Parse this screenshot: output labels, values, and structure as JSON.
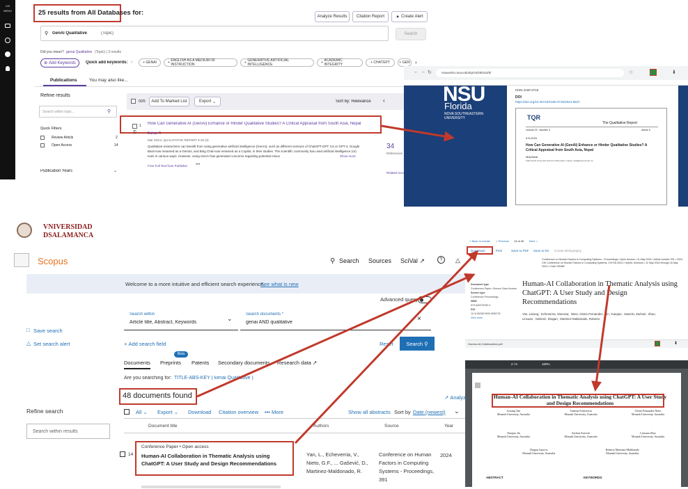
{
  "wos": {
    "rail_items": [
      "LIB",
      "MENU"
    ],
    "results_heading": "25 results from All Databases for:",
    "analyze_btn": "Analyze Results",
    "citation_btn": "Citation Report",
    "alert_btn": "Create Alert",
    "query": "GenAI Qualitative",
    "query_suffix": "(Topic)",
    "search_btn": "Search",
    "did_you_mean": "Did you mean?",
    "did_you_mean_value": "genai Qualitative",
    "did_you_mean_rest": "(Topic) | 3 results",
    "add_keywords": "Add Keywords",
    "quick_add": "Quick add keywords:",
    "chips": [
      "GENAI",
      "ENGLISH AS A MEDIUM OF INSTRUCTION",
      "GENERATIVE ARTIFICIAL INTELLIGENCE",
      "ACADEMIC INTEGRITY",
      "CHATGPT",
      "GEN"
    ],
    "tab_publications": "Publications",
    "tab_also_like": "You may also like...",
    "refine": "Refine results",
    "search_within_ph": "Search within topic...",
    "quick_filters": "Quick Filters",
    "filters": [
      {
        "label": "Review Article",
        "count": "2"
      },
      {
        "label": "Open Access",
        "count": "14"
      }
    ],
    "pub_years": "Publication Years",
    "selected": "0/25",
    "add_marked": "Add To Marked List",
    "export": "Export",
    "sort_by": "Sort by: Relevance",
    "record_num": "1",
    "record_title": "How Can Generative AI (GenAI) Enhance or Hinder Qualitative Studies? A Critical Appraisal from South Asia, Nepal",
    "record_author": "Bahat, R",
    "record_meta": "Mar 2024 | QUALITATIVE REPORT ▾ 29 (3)",
    "abstract_line1": "Qualitative researchers can benefit from using generative artificial intelligence (GenAI), such as different versions of ChatGPT-GPT 3.5 or GPT-4, Google",
    "abstract_line2": "Bard-now renamed as a Gemini, and Bing Chat-now renamed as a Copilot, in their studies. The scientific community has used artificial intelligence (AI)",
    "abstract_line3": "tools in various ways. However, using GenAI has generated concerns regarding potential misus",
    "show_more": "Show more",
    "full_text": "Free Full Text from Publisher",
    "citations": "34",
    "citations_label": "References",
    "related": "Related records"
  },
  "nsu": {
    "url": "nsuworks.nova.edu/tqr/vol29/iss3/5/",
    "logo": "NSU",
    "florida": "Florida",
    "sub1": "NOVA SOUTHEASTERN",
    "sub2": "UNIVERSITY",
    "issn_label": "ISSN 2160-3715",
    "doi_label": "DOI",
    "doi": "https://doi.org/10.46743/2160-3715/2024.6637",
    "tqr": "TQR",
    "tqr_full": "The Qualitative Report",
    "vol": "Volume 29 · Number 3",
    "article": "Article 5",
    "date": "3-5-2024",
    "paper_title": "How Can Generative AI (GenAI) Enhance or Hinder Qualitative Studies? A Critical Appraisal from South Asia, Nepal",
    "paper_author": "Niraj Bahat",
    "paper_affil": "Kathmandu University School of Education, Nepal, niraj@kusoed.edu.np"
  },
  "scopus": {
    "univ1": "VNIVERSIDAD",
    "univ2": "DSALAMANCA",
    "brand": "Scopus",
    "nav": [
      "Search",
      "Sources",
      "SciVal ↗"
    ],
    "welcome": "Welcome to a more intuitive and efficient search experience.",
    "see_new": "See what is new",
    "advanced": "Advanced query",
    "search_within_label": "Search within",
    "search_within_value": "Article title, Abstract, Keywords",
    "search_docs_label": "Search documents *",
    "search_docs_value": "genai AND qualitative",
    "save_search": "Save search",
    "set_alert": "Set search alert",
    "add_field": "Add search field",
    "reset": "Reset",
    "search_btn": "Search",
    "beta": "Beta",
    "tabs": [
      "Documents",
      "Preprints",
      "Patents",
      "Secondary documents",
      "Research data ↗"
    ],
    "searching_for": "Are you searching for:",
    "suggestion": "TITLE-ABS-KEY ( kenai Qualitative )",
    "found": "48 documents found",
    "analyze": "Analyze",
    "refine": "Refine search",
    "refine_ph": "Search within results",
    "toolbar": [
      "All",
      "Export",
      "Download",
      "Citation overview",
      "••• More"
    ],
    "show_abstracts": "Show all abstracts",
    "sort_label": "Sort by",
    "sort_value": "Date (newest)",
    "cols": [
      "Document title",
      "Authors",
      "Source",
      "Year"
    ],
    "row_num": "14",
    "row_type": "Conference Paper • Open access",
    "row_title": "Human-AI Collaboration in Thematic Analysis using ChatGPT: A User Study and Design Recommendations",
    "row_authors": "Yan, L., Echeverria, V., Nieto, G.F., ... Gašević, D., Martinez-Maldonado, R.",
    "row_source": "Conference on Human Factors in Computing Systems - Proceedings, 391",
    "row_year": "2024"
  },
  "article": {
    "back": "< Back to results",
    "prev": "< Previous",
    "count": "14 of 48",
    "next": "Next >",
    "actions": [
      "Download",
      "Print",
      "Save to PDF",
      "Save to list",
      "Create bibliography"
    ],
    "meta": "Conference on Human Factors in Computing Systems - Proceedings • Open Access • 11 May 2024 • Article number 391 • 2024 CHI Conference on Human Factors in Computing Systems, CHI EA 2024 • Hybrid, Honolulu • 11 May 2024 through 16 May 2024 • Code 199482",
    "side_labels": [
      "Document type",
      "Conference Paper • Bronze Open Access",
      "Source type",
      "Conference Proceedings",
      "ISBN",
      "979-840070330-0",
      "DOI",
      "10.1145/3613905.3650732",
      "View more"
    ],
    "title": "Human-AI Collaboration in Thematic Analysis using ChatGPT: A User Study and Design Recommendations",
    "authors": [
      "Yan, Lixiang",
      "Echeverria, Vanessa",
      "Nieto, Gloria Fernandez",
      "Jin, Yueqiao",
      "Swiecki, Zachari",
      "Zhao, Linxuan",
      "Gašević, Dragan",
      "Martinez-Maldonado, Roberto"
    ],
    "pdf_name": "Human-AI-Collaboration.pdf",
    "pdf_page": "2 / 8",
    "pdf_zoom": "100%",
    "pdf_title": "Human-AI Collaboration in Thematic Analysis using ChatGPT: A User Study and Design Recommendations",
    "pdf_authors": [
      {
        "n": "Lixiang Yan",
        "a": "Monash University, Australia"
      },
      {
        "n": "Vanessa Echeverria",
        "a": "Monash University, Australia"
      },
      {
        "n": "Gloria Fernandez Nieto",
        "a": "Monash University, Australia"
      },
      {
        "n": "Yueqiao Jin",
        "a": "Monash University, Australia"
      },
      {
        "n": "Zachari Swiecki",
        "a": "Monash University, Australia"
      },
      {
        "n": "Linxuan Zhao",
        "a": "Monash University, Australia"
      },
      {
        "n": "Dragan Gasevic",
        "a": "Monash University, Australia"
      },
      {
        "n": "Roberto Martinez-Maldonado",
        "a": "Monash University, Australia"
      }
    ],
    "abstract_h": "ABSTRACT",
    "keywords_h": "KEYWORDS"
  },
  "colors": {
    "red": "#c0392b",
    "scopus_blue": "#1f6fb5",
    "nsu_blue": "#1b3f78",
    "orange": "#e9711c"
  }
}
